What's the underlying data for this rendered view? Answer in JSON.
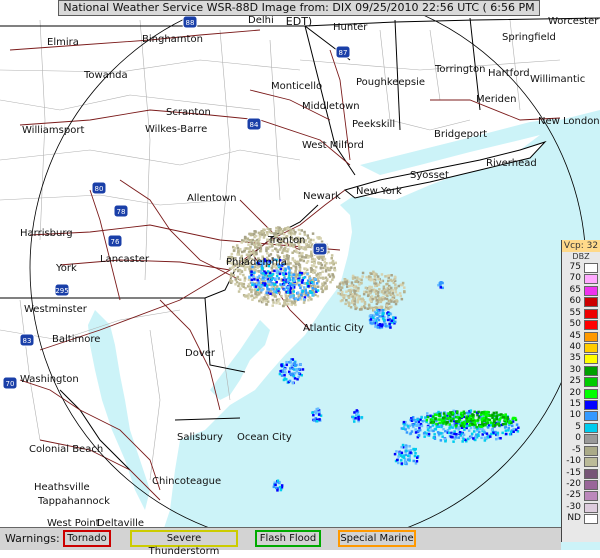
{
  "title": "National Weather Service WSR-88D Image from: DIX 09/25/2010 22:56 UTC ( 6:56 PM EDT)",
  "colors": {
    "ocean": "#ccf3f8",
    "land": "#ffffff",
    "county": "#b0b0b0",
    "state": "#000000",
    "road": "#7b1b1b",
    "ring": "#000000"
  },
  "legend": {
    "product": "Vcp: 32",
    "unit": "DBZ",
    "items": [
      {
        "value": "75",
        "color": "#ffffff"
      },
      {
        "value": "70",
        "color": "#ffaaff"
      },
      {
        "value": "65",
        "color": "#ee33ee"
      },
      {
        "value": "60",
        "color": "#cc0000"
      },
      {
        "value": "55",
        "color": "#ee0000"
      },
      {
        "value": "50",
        "color": "#ff0000"
      },
      {
        "value": "45",
        "color": "#ff9900"
      },
      {
        "value": "40",
        "color": "#ffcc00"
      },
      {
        "value": "35",
        "color": "#ffff00"
      },
      {
        "value": "30",
        "color": "#00a000"
      },
      {
        "value": "25",
        "color": "#00cc00"
      },
      {
        "value": "20",
        "color": "#00ff00"
      },
      {
        "value": "15",
        "color": "#0000ff"
      },
      {
        "value": "10",
        "color": "#3399ff"
      },
      {
        "value": "5",
        "color": "#00ccee"
      },
      {
        "value": "0",
        "color": "#999999"
      },
      {
        "value": "-5",
        "color": "#aaaa88"
      },
      {
        "value": "-10",
        "color": "#bbbb99"
      },
      {
        "value": "-15",
        "color": "#775577"
      },
      {
        "value": "-20",
        "color": "#996699"
      },
      {
        "value": "-25",
        "color": "#bb88bb"
      },
      {
        "value": "-30",
        "color": "#ddccdd"
      },
      {
        "value": "ND",
        "color": "#ffffff"
      }
    ]
  },
  "warnings": {
    "label": "Warnings:",
    "items": [
      {
        "name": "Tornado",
        "border": "#cc0000"
      },
      {
        "name": "Severe Thunderstorm",
        "border": "#cccc00"
      },
      {
        "name": "Flash Flood",
        "border": "#00aa00"
      },
      {
        "name": "Special Marine",
        "border": "#ff9900"
      }
    ]
  },
  "cities": [
    "Delhi",
    "Hunter",
    "Worcester",
    "Elmira",
    "Binghamton",
    "Springfield",
    "Torrington",
    "Hartford",
    "Willimantic",
    "Towanda",
    "Monticello",
    "Poughkeepsie",
    "Meriden",
    "New London",
    "Middletown",
    "Scranton",
    "Peekskill",
    "Wilkes-Barre",
    "Williamsport",
    "Bridgeport",
    "West Milford",
    "Riverhead",
    "Syosset",
    "Allentown",
    "Newark",
    "New York",
    "Trenton",
    "Harrisburg",
    "Lancaster",
    "Philadelphia",
    "York",
    "Westminster",
    "Atlantic City",
    "Baltimore",
    "Dover",
    "Washington",
    "Salisbury",
    "Ocean City",
    "Colonial Beach",
    "Chincoteague",
    "Heathsville",
    "Tappahannock",
    "West Point",
    "Deltaville"
  ],
  "highways": [
    "88",
    "87",
    "84",
    "80",
    "78",
    "76",
    "95",
    "295",
    "83",
    "70",
    "66",
    "81",
    "195",
    "287"
  ]
}
